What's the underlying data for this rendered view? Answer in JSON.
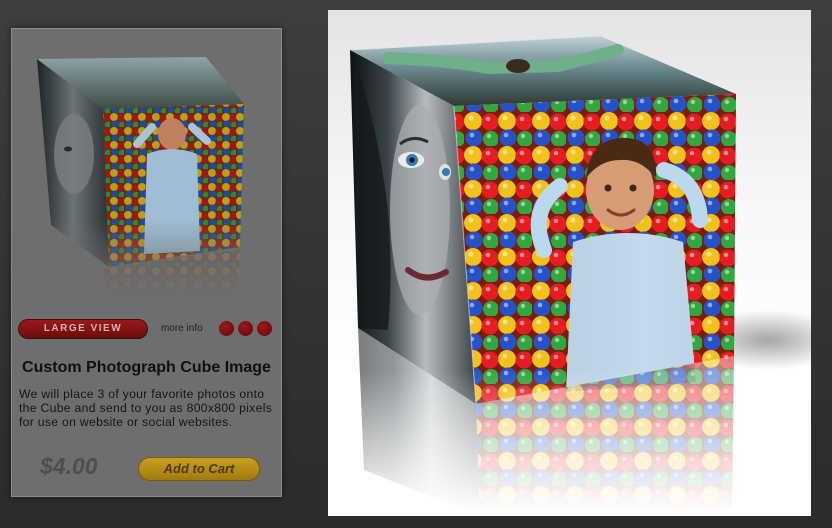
{
  "card": {
    "large_view_label": "LARGE VIEW",
    "more_info_label": "more info",
    "title": "Custom Photograph Cube Image",
    "description": "We will place 3 of your favorite photos onto the Cube and send to you as 800x800 pixels for use on website or social websites.",
    "price": "$4.00",
    "add_to_cart_label": "Add to Cart",
    "option_dots": [
      "option-1",
      "option-2",
      "option-3"
    ]
  },
  "preview": {
    "faces": {
      "top": "adult-lying-in-grass-photo",
      "left": "woman-portrait-photo",
      "right": "boy-in-ball-pit-photo"
    }
  },
  "colors": {
    "page_bg": "#333333",
    "card_bg": "#6e6e6e",
    "accent_red": "#8a1414",
    "cart_gold": "#c8a020",
    "panel_bg": "#ffffff"
  }
}
